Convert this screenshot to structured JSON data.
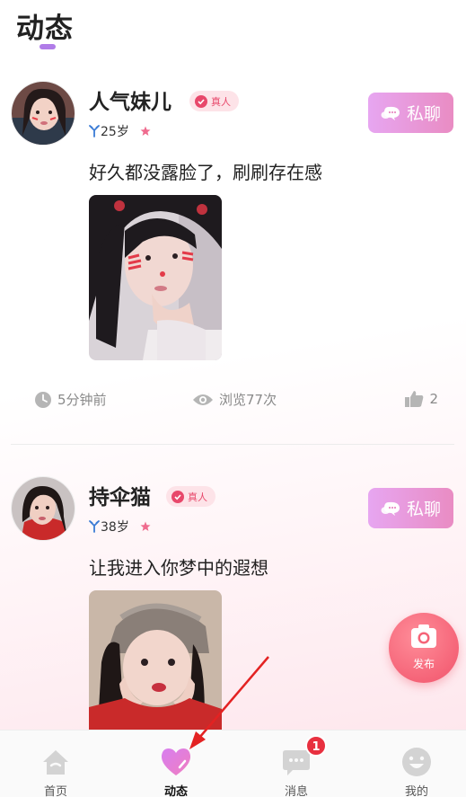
{
  "header": {
    "title": "动态"
  },
  "posts": [
    {
      "username": "人气妹儿",
      "badge": "真人",
      "age": "25岁",
      "chat_label": "私聊",
      "text": "好久都没露脸了，刷刷存在感",
      "time": "5分钟前",
      "views": "浏览77次",
      "likes": "2"
    },
    {
      "username": "持伞猫",
      "badge": "真人",
      "age": "38岁",
      "chat_label": "私聊",
      "text": "让我进入你梦中的遐想"
    }
  ],
  "fab": {
    "label": "发布"
  },
  "tabbar": {
    "items": [
      {
        "label": "首页",
        "icon": "home-icon"
      },
      {
        "label": "动态",
        "icon": "heart-icon",
        "active": true
      },
      {
        "label": "消息",
        "icon": "message-icon",
        "badge": "1"
      },
      {
        "label": "我的",
        "icon": "smiley-icon"
      }
    ]
  },
  "colors": {
    "accent_purple": "#b07ce8",
    "chat_button": "#e98cc3",
    "badge_red": "#e8486b",
    "fab": "#f56478",
    "annotation_arrow": "#e32222"
  }
}
